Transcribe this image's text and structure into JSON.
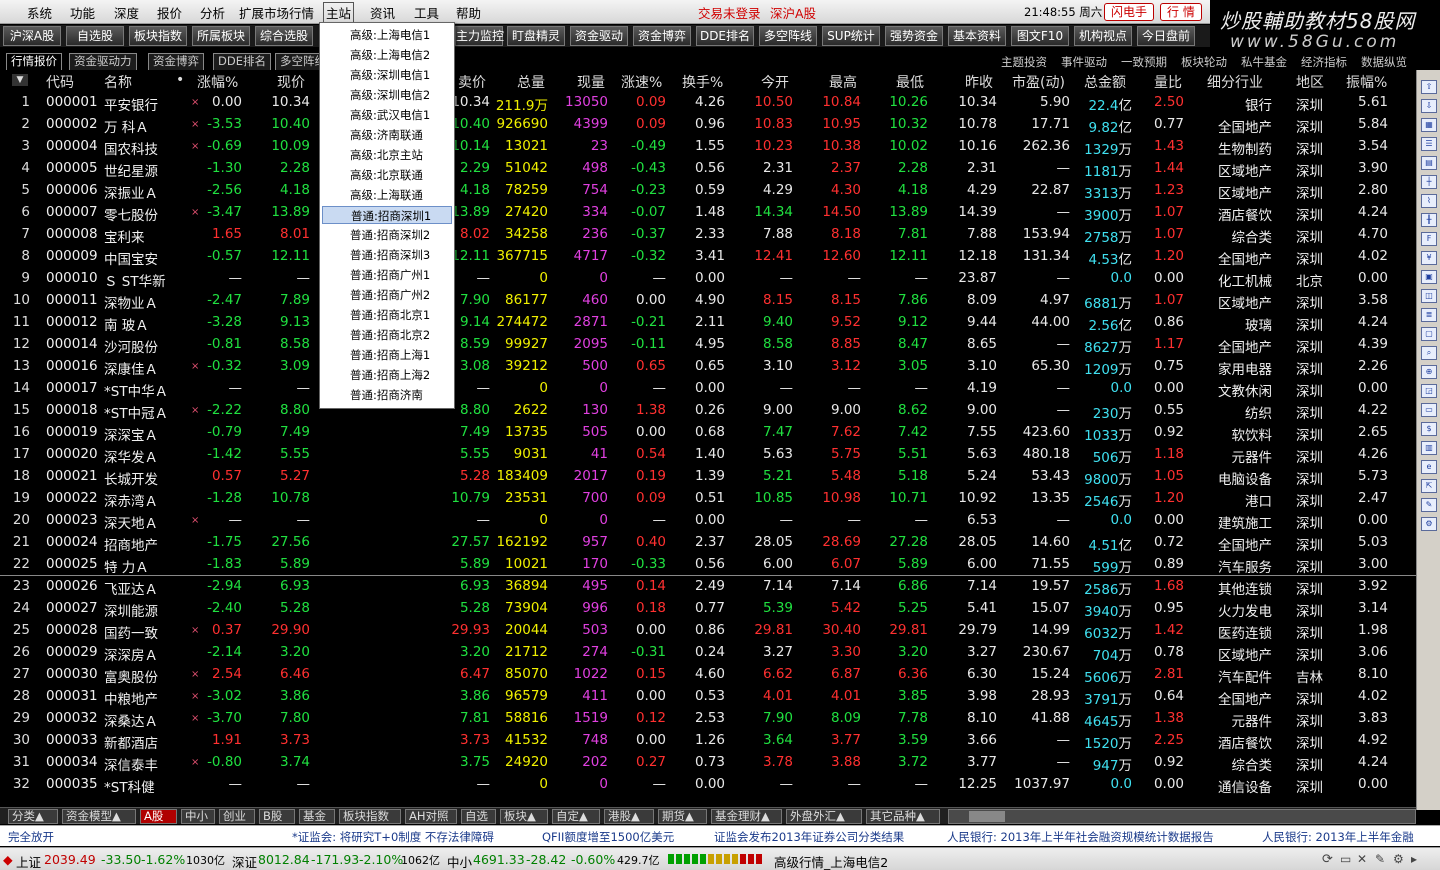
{
  "menubar": {
    "items": [
      "系统",
      "功能",
      "深度",
      "报价",
      "分析",
      "扩展市场行情",
      "主站",
      "资讯",
      "工具",
      "帮助"
    ],
    "trade_status": "交易未登录",
    "market": "深沪A股",
    "clock": "21:48:55 周六",
    "flash_btn": "闪电手",
    "quote_btn": "行 情"
  },
  "brand": {
    "line1": "炒股輔助教材58股网",
    "line2": "www.58Gu.com"
  },
  "toolbar": {
    "buttons": [
      "沪深A股",
      "自选股",
      "板块指数",
      "所属板块",
      "综合选股",
      "",
      "主力监控",
      "盯盘精灵",
      "资金驱动",
      "资金博弈",
      "DDE排名",
      "多空阵线",
      "SUP统计",
      "强势资金",
      "基本资料",
      "图文F10",
      "机构视点",
      "今日盘前"
    ]
  },
  "tabs": {
    "left": [
      "行情报价",
      "资金驱动力",
      "资金博弈",
      "DDE排名",
      "多空阵线"
    ],
    "right": [
      "主题投资",
      "事件驱动",
      "一致预期",
      "板块轮动",
      "私牛基金",
      "经济指标",
      "数据纵览"
    ]
  },
  "columns": [
    "代码",
    "名称",
    "涨幅%",
    "现价",
    "卖价",
    "总量",
    "现量",
    "涨速%",
    "换手%",
    "今开",
    "最高",
    "最低",
    "昨收",
    "市盈(动)",
    "总金额",
    "量比",
    "细分行业",
    "地区",
    "振幅%"
  ],
  "dropdown": {
    "items": [
      "高级:上海电信1",
      "高级:上海电信2",
      "高级:深圳电信1",
      "高级:深圳电信2",
      "高级:武汉电信1",
      "高级:济南联通",
      "高级:北京主站",
      "高级:北京联通",
      "高级:上海联通",
      "普通:招商深圳1",
      "普通:招商深圳2",
      "普通:招商深圳3",
      "普通:招商广州1",
      "普通:招商广州2",
      "普通:招商北京1",
      "普通:招商北京2",
      "普通:招商上海1",
      "普通:招商上海2",
      "普通:招商济南"
    ],
    "selected": 9
  },
  "rows": [
    {
      "n": "1",
      "code": "000001",
      "name": "平安银行",
      "x": "×",
      "chg": "0.00",
      "price": "10.34",
      "sell": "10.34",
      "vol": "211.9万",
      "cur": "13050",
      "spd": "0.09",
      "turn": "4.26",
      "open": "10.50",
      "high": "10.84",
      "low": "10.26",
      "prev": "10.34",
      "pe": "5.90",
      "amt": "22.4",
      "amtu": "亿",
      "vr": "2.50",
      "ind": "银行",
      "reg": "深圳",
      "amp": "5.61"
    },
    {
      "n": "2",
      "code": "000002",
      "name": "万  科Ａ",
      "x": "×",
      "chg": "-3.53",
      "price": "10.40",
      "sell": "10.40",
      "vol": "926690",
      "cur": "4399",
      "spd": "0.09",
      "turn": "0.96",
      "open": "10.83",
      "high": "10.95",
      "low": "10.32",
      "prev": "10.78",
      "pe": "17.71",
      "amt": "9.82",
      "amtu": "亿",
      "vr": "0.77",
      "ind": "全国地产",
      "reg": "深圳",
      "amp": "5.84"
    },
    {
      "n": "3",
      "code": "000004",
      "name": "国农科技",
      "x": "×",
      "chg": "-0.69",
      "price": "10.09",
      "sell": "10.14",
      "vol": "13021",
      "cur": "23",
      "spd": "-0.49",
      "turn": "1.55",
      "open": "10.23",
      "high": "10.38",
      "low": "10.02",
      "prev": "10.16",
      "pe": "262.36",
      "amt": "1329",
      "amtu": "万",
      "vr": "1.43",
      "ind": "生物制药",
      "reg": "深圳",
      "amp": "3.54"
    },
    {
      "n": "4",
      "code": "000005",
      "name": "世纪星源",
      "x": "",
      "chg": "-1.30",
      "price": "2.28",
      "sell": "2.29",
      "vol": "51042",
      "cur": "498",
      "spd": "-0.43",
      "turn": "0.56",
      "open": "2.31",
      "high": "2.37",
      "low": "2.28",
      "prev": "2.31",
      "pe": "—",
      "amt": "1181",
      "amtu": "万",
      "vr": "1.44",
      "ind": "区域地产",
      "reg": "深圳",
      "amp": "3.90"
    },
    {
      "n": "5",
      "code": "000006",
      "name": "深振业Ａ",
      "x": "",
      "chg": "-2.56",
      "price": "4.18",
      "sell": "4.18",
      "vol": "78259",
      "cur": "754",
      "spd": "-0.23",
      "turn": "0.59",
      "open": "4.29",
      "high": "4.30",
      "low": "4.18",
      "prev": "4.29",
      "pe": "22.87",
      "amt": "3313",
      "amtu": "万",
      "vr": "1.23",
      "ind": "区域地产",
      "reg": "深圳",
      "amp": "2.80"
    },
    {
      "n": "6",
      "code": "000007",
      "name": "零七股份",
      "x": "×",
      "chg": "-3.47",
      "price": "13.89",
      "sell": "13.89",
      "vol": "27420",
      "cur": "334",
      "spd": "-0.07",
      "turn": "1.48",
      "open": "14.34",
      "high": "14.50",
      "low": "13.89",
      "prev": "14.39",
      "pe": "—",
      "amt": "3900",
      "amtu": "万",
      "vr": "1.07",
      "ind": "酒店餐饮",
      "reg": "深圳",
      "amp": "4.24"
    },
    {
      "n": "7",
      "code": "000008",
      "name": "宝利来",
      "x": "",
      "chg": "1.65",
      "price": "8.01",
      "sell": "8.02",
      "vol": "34258",
      "cur": "236",
      "spd": "-0.37",
      "turn": "2.33",
      "open": "7.88",
      "high": "8.18",
      "low": "7.81",
      "prev": "7.88",
      "pe": "153.94",
      "amt": "2758",
      "amtu": "万",
      "vr": "1.07",
      "ind": "综合类",
      "reg": "深圳",
      "amp": "4.70"
    },
    {
      "n": "8",
      "code": "000009",
      "name": "中国宝安",
      "x": "",
      "chg": "-0.57",
      "price": "12.11",
      "sell": "12.11",
      "vol": "367715",
      "cur": "4717",
      "spd": "-0.32",
      "turn": "3.41",
      "open": "12.41",
      "high": "12.60",
      "low": "12.11",
      "prev": "12.18",
      "pe": "131.34",
      "amt": "4.53",
      "amtu": "亿",
      "vr": "1.20",
      "ind": "全国地产",
      "reg": "深圳",
      "amp": "4.02"
    },
    {
      "n": "9",
      "code": "000010",
      "name": "Ｓ ST华新",
      "x": "",
      "chg": "—",
      "price": "—",
      "sell": "—",
      "vol": "0",
      "cur": "0",
      "spd": "—",
      "turn": "0.00",
      "open": "—",
      "high": "—",
      "low": "—",
      "prev": "23.87",
      "pe": "—",
      "amt": "0.0",
      "amtu": "",
      "vr": "0.00",
      "ind": "化工机械",
      "reg": "北京",
      "amp": "0.00"
    },
    {
      "n": "10",
      "code": "000011",
      "name": "深物业Ａ",
      "x": "",
      "chg": "-2.47",
      "price": "7.89",
      "sell": "7.90",
      "vol": "86177",
      "cur": "460",
      "spd": "0.00",
      "turn": "4.90",
      "open": "8.15",
      "high": "8.15",
      "low": "7.86",
      "prev": "8.09",
      "pe": "4.97",
      "amt": "6881",
      "amtu": "万",
      "vr": "1.07",
      "ind": "区域地产",
      "reg": "深圳",
      "amp": "3.58"
    },
    {
      "n": "11",
      "code": "000012",
      "name": "南  玻Ａ",
      "x": "",
      "chg": "-3.28",
      "price": "9.13",
      "sell": "9.14",
      "vol": "274472",
      "cur": "2871",
      "spd": "-0.21",
      "turn": "2.11",
      "open": "9.40",
      "high": "9.52",
      "low": "9.12",
      "prev": "9.44",
      "pe": "44.00",
      "amt": "2.56",
      "amtu": "亿",
      "vr": "0.86",
      "ind": "玻璃",
      "reg": "深圳",
      "amp": "4.24"
    },
    {
      "n": "12",
      "code": "000014",
      "name": "沙河股份",
      "x": "",
      "chg": "-0.81",
      "price": "8.58",
      "sell": "8.59",
      "vol": "99927",
      "cur": "2095",
      "spd": "-0.11",
      "turn": "4.95",
      "open": "8.58",
      "high": "8.85",
      "low": "8.47",
      "prev": "8.65",
      "pe": "—",
      "amt": "8627",
      "amtu": "万",
      "vr": "1.17",
      "ind": "全国地产",
      "reg": "深圳",
      "amp": "4.39"
    },
    {
      "n": "13",
      "code": "000016",
      "name": "深康佳Ａ",
      "x": "×",
      "chg": "-0.32",
      "price": "3.09",
      "sell": "3.08",
      "vol": "39212",
      "cur": "500",
      "spd": "0.65",
      "turn": "0.65",
      "open": "3.10",
      "high": "3.12",
      "low": "3.05",
      "prev": "3.10",
      "pe": "65.30",
      "amt": "1209",
      "amtu": "万",
      "vr": "0.75",
      "ind": "家用电器",
      "reg": "深圳",
      "amp": "2.26"
    },
    {
      "n": "14",
      "code": "000017",
      "name": "*ST中华Ａ",
      "x": "",
      "chg": "—",
      "price": "—",
      "sell": "—",
      "vol": "0",
      "cur": "0",
      "spd": "—",
      "turn": "0.00",
      "open": "—",
      "high": "—",
      "low": "—",
      "prev": "4.19",
      "pe": "—",
      "amt": "0.0",
      "amtu": "",
      "vr": "0.00",
      "ind": "文教休闲",
      "reg": "深圳",
      "amp": "0.00"
    },
    {
      "n": "15",
      "code": "000018",
      "name": "*ST中冠Ａ",
      "x": "×",
      "chg": "-2.22",
      "price": "8.80",
      "sell": "8.80",
      "vol": "2622",
      "cur": "130",
      "spd": "1.38",
      "turn": "0.26",
      "open": "9.00",
      "high": "9.00",
      "low": "8.62",
      "prev": "9.00",
      "pe": "—",
      "amt": "230",
      "amtu": "万",
      "vr": "0.55",
      "ind": "纺织",
      "reg": "深圳",
      "amp": "4.22"
    },
    {
      "n": "16",
      "code": "000019",
      "name": "深深宝Ａ",
      "x": "",
      "chg": "-0.79",
      "price": "7.49",
      "sell": "7.49",
      "vol": "13735",
      "cur": "505",
      "spd": "0.00",
      "turn": "0.68",
      "open": "7.47",
      "high": "7.62",
      "low": "7.42",
      "prev": "7.55",
      "pe": "423.60",
      "amt": "1033",
      "amtu": "万",
      "vr": "0.92",
      "ind": "软饮料",
      "reg": "深圳",
      "amp": "2.65"
    },
    {
      "n": "17",
      "code": "000020",
      "name": "深华发Ａ",
      "x": "",
      "chg": "-1.42",
      "price": "5.55",
      "sell": "5.55",
      "vol": "9031",
      "cur": "41",
      "spd": "0.54",
      "turn": "1.40",
      "open": "5.63",
      "high": "5.75",
      "low": "5.51",
      "prev": "5.63",
      "pe": "480.18",
      "amt": "506",
      "amtu": "万",
      "vr": "1.18",
      "ind": "元器件",
      "reg": "深圳",
      "amp": "4.26"
    },
    {
      "n": "18",
      "code": "000021",
      "name": "长城开发",
      "x": "",
      "chg": "0.57",
      "price": "5.27",
      "sell": "5.28",
      "vol": "183409",
      "cur": "2017",
      "spd": "0.19",
      "turn": "1.39",
      "open": "5.21",
      "high": "5.48",
      "low": "5.18",
      "prev": "5.24",
      "pe": "53.43",
      "amt": "9800",
      "amtu": "万",
      "vr": "1.05",
      "ind": "电脑设备",
      "reg": "深圳",
      "amp": "5.73"
    },
    {
      "n": "19",
      "code": "000022",
      "name": "深赤湾Ａ",
      "x": "",
      "chg": "-1.28",
      "price": "10.78",
      "sell": "10.79",
      "vol": "23531",
      "cur": "700",
      "spd": "0.09",
      "turn": "0.51",
      "open": "10.85",
      "high": "10.98",
      "low": "10.71",
      "prev": "10.92",
      "pe": "13.35",
      "amt": "2546",
      "amtu": "万",
      "vr": "1.20",
      "ind": "港口",
      "reg": "深圳",
      "amp": "2.47"
    },
    {
      "n": "20",
      "code": "000023",
      "name": "深天地Ａ",
      "x": "×",
      "chg": "—",
      "price": "—",
      "sell": "—",
      "vol": "0",
      "cur": "0",
      "spd": "—",
      "turn": "0.00",
      "open": "—",
      "high": "—",
      "low": "—",
      "prev": "6.53",
      "pe": "—",
      "amt": "0.0",
      "amtu": "",
      "vr": "0.00",
      "ind": "建筑施工",
      "reg": "深圳",
      "amp": "0.00"
    },
    {
      "n": "21",
      "code": "000024",
      "name": "招商地产",
      "x": "",
      "chg": "-1.75",
      "price": "27.56",
      "sell": "27.57",
      "vol": "162192",
      "cur": "957",
      "spd": "0.40",
      "turn": "2.37",
      "open": "28.05",
      "high": "28.69",
      "low": "27.28",
      "prev": "28.05",
      "pe": "14.60",
      "amt": "4.51",
      "amtu": "亿",
      "vr": "0.72",
      "ind": "全国地产",
      "reg": "深圳",
      "amp": "5.03"
    },
    {
      "n": "22",
      "code": "000025",
      "name": "特  力Ａ",
      "x": "",
      "chg": "-1.83",
      "price": "5.89",
      "sell": "5.89",
      "vol": "10021",
      "cur": "170",
      "spd": "-0.33",
      "turn": "0.56",
      "open": "6.00",
      "high": "6.07",
      "low": "5.89",
      "prev": "6.00",
      "pe": "71.55",
      "amt": "599",
      "amtu": "万",
      "vr": "0.89",
      "ind": "汽车服务",
      "reg": "深圳",
      "amp": "3.00"
    },
    {
      "n": "23",
      "code": "000026",
      "name": "飞亚达Ａ",
      "x": "",
      "chg": "-2.94",
      "price": "6.93",
      "sell": "6.93",
      "vol": "36894",
      "cur": "495",
      "spd": "0.14",
      "turn": "2.49",
      "open": "7.14",
      "high": "7.14",
      "low": "6.86",
      "prev": "7.14",
      "pe": "19.57",
      "amt": "2586",
      "amtu": "万",
      "vr": "1.68",
      "ind": "其他连锁",
      "reg": "深圳",
      "amp": "3.92"
    },
    {
      "n": "24",
      "code": "000027",
      "name": "深圳能源",
      "x": "",
      "chg": "-2.40",
      "price": "5.28",
      "sell": "5.28",
      "vol": "73904",
      "cur": "996",
      "spd": "0.18",
      "turn": "0.77",
      "open": "5.39",
      "high": "5.42",
      "low": "5.25",
      "prev": "5.41",
      "pe": "15.07",
      "amt": "3940",
      "amtu": "万",
      "vr": "0.95",
      "ind": "火力发电",
      "reg": "深圳",
      "amp": "3.14"
    },
    {
      "n": "25",
      "code": "000028",
      "name": "国药一致",
      "x": "×",
      "chg": "0.37",
      "price": "29.90",
      "sell": "29.93",
      "vol": "20044",
      "cur": "503",
      "spd": "0.00",
      "turn": "0.86",
      "open": "29.81",
      "high": "30.40",
      "low": "29.81",
      "prev": "29.79",
      "pe": "14.99",
      "amt": "6032",
      "amtu": "万",
      "vr": "1.42",
      "ind": "医药连锁",
      "reg": "深圳",
      "amp": "1.98"
    },
    {
      "n": "26",
      "code": "000029",
      "name": "深深房Ａ",
      "x": "",
      "chg": "-2.14",
      "price": "3.20",
      "sell": "3.20",
      "vol": "21712",
      "cur": "274",
      "spd": "-0.31",
      "turn": "0.24",
      "open": "3.27",
      "high": "3.30",
      "low": "3.20",
      "prev": "3.27",
      "pe": "230.67",
      "amt": "704",
      "amtu": "万",
      "vr": "0.78",
      "ind": "区域地产",
      "reg": "深圳",
      "amp": "3.06"
    },
    {
      "n": "27",
      "code": "000030",
      "name": "富奥股份",
      "x": "×",
      "chg": "2.54",
      "price": "6.46",
      "sell": "6.47",
      "vol": "85070",
      "cur": "1022",
      "spd": "0.15",
      "turn": "4.60",
      "open": "6.62",
      "high": "6.87",
      "low": "6.36",
      "prev": "6.30",
      "pe": "15.24",
      "amt": "5606",
      "amtu": "万",
      "vr": "2.81",
      "ind": "汽车配件",
      "reg": "吉林",
      "amp": "8.10"
    },
    {
      "n": "28",
      "code": "000031",
      "name": "中粮地产",
      "x": "×",
      "chg": "-3.02",
      "price": "3.86",
      "sell": "3.86",
      "vol": "96579",
      "cur": "411",
      "spd": "0.00",
      "turn": "0.53",
      "open": "4.01",
      "high": "4.01",
      "low": "3.85",
      "prev": "3.98",
      "pe": "28.93",
      "amt": "3791",
      "amtu": "万",
      "vr": "0.64",
      "ind": "全国地产",
      "reg": "深圳",
      "amp": "4.02"
    },
    {
      "n": "29",
      "code": "000032",
      "name": "深桑达Ａ",
      "x": "×",
      "chg": "-3.70",
      "price": "7.80",
      "sell": "7.81",
      "vol": "58816",
      "cur": "1519",
      "spd": "0.12",
      "turn": "2.53",
      "open": "7.90",
      "high": "8.09",
      "low": "7.78",
      "prev": "8.10",
      "pe": "41.88",
      "amt": "4645",
      "amtu": "万",
      "vr": "1.38",
      "ind": "元器件",
      "reg": "深圳",
      "amp": "3.83"
    },
    {
      "n": "30",
      "code": "000033",
      "name": "新都酒店",
      "x": "",
      "chg": "1.91",
      "price": "3.73",
      "sell": "3.73",
      "vol": "41532",
      "cur": "748",
      "spd": "0.00",
      "turn": "1.26",
      "open": "3.64",
      "high": "3.77",
      "low": "3.59",
      "prev": "3.66",
      "pe": "—",
      "amt": "1520",
      "amtu": "万",
      "vr": "2.25",
      "ind": "酒店餐饮",
      "reg": "深圳",
      "amp": "4.92"
    },
    {
      "n": "31",
      "code": "000034",
      "name": "深信泰丰",
      "x": "×",
      "chg": "-0.80",
      "price": "3.74",
      "sell": "3.75",
      "vol": "24920",
      "cur": "202",
      "spd": "0.27",
      "turn": "0.73",
      "open": "3.78",
      "high": "3.88",
      "low": "3.72",
      "prev": "3.77",
      "pe": "—",
      "amt": "947",
      "amtu": "万",
      "vr": "0.92",
      "ind": "综合类",
      "reg": "深圳",
      "amp": "4.24"
    },
    {
      "n": "32",
      "code": "000035",
      "name": "*ST科健",
      "x": "",
      "chg": "—",
      "price": "—",
      "sell": "—",
      "vol": "0",
      "cur": "0",
      "spd": "—",
      "turn": "0.00",
      "open": "—",
      "high": "—",
      "low": "—",
      "prev": "12.25",
      "pe": "1037.97",
      "amt": "0.0",
      "amtu": "",
      "vr": "0.00",
      "ind": "通信设备",
      "reg": "深圳",
      "amp": "0.00"
    }
  ],
  "bottom_tabs": [
    "分类▲",
    "资金模型▲",
    "A股",
    "中小",
    "创业",
    "B股",
    "基金",
    "板块指数",
    "AH对照",
    "自选",
    "板块▲",
    "自定▲",
    "港股▲",
    "期货▲",
    "基金理财▲",
    "外盘外汇▲",
    "其它品种▲"
  ],
  "ticker": [
    "完全放开",
    "*证监会: 将研究T+0制度 不存法律障碍",
    "QFII额度增至1500亿美元",
    "证监会发布2013年证券公司分类结果",
    "人民银行: 2013年上半年社会融资规模统计数据报告",
    "人民银行: 2013年上半年金融"
  ],
  "status": {
    "sh_label": "上证",
    "sh_val": "2039.49",
    "sh_chg": "-33.50",
    "sh_pct": "-1.62%",
    "sh_amt": "1030亿",
    "sz_label": "深证",
    "sz_val": "8012.84",
    "sz_chg": "-171.93",
    "sz_pct": "-2.10%",
    "sz_amt": "1062亿",
    "zx_label": "中小",
    "zx_val": "4691.33",
    "zx_chg": "-28.42",
    "zx_pct": "-0.60%",
    "zx_amt": "429.7亿",
    "server": "高级行情_上海电信2"
  },
  "colors": {
    "up": "#ff3030",
    "down": "#20e040",
    "volume": "#f0f000",
    "current_vol": "#e040e0",
    "amount": "#40e0f0",
    "selected_menu": "#c9daf2"
  }
}
